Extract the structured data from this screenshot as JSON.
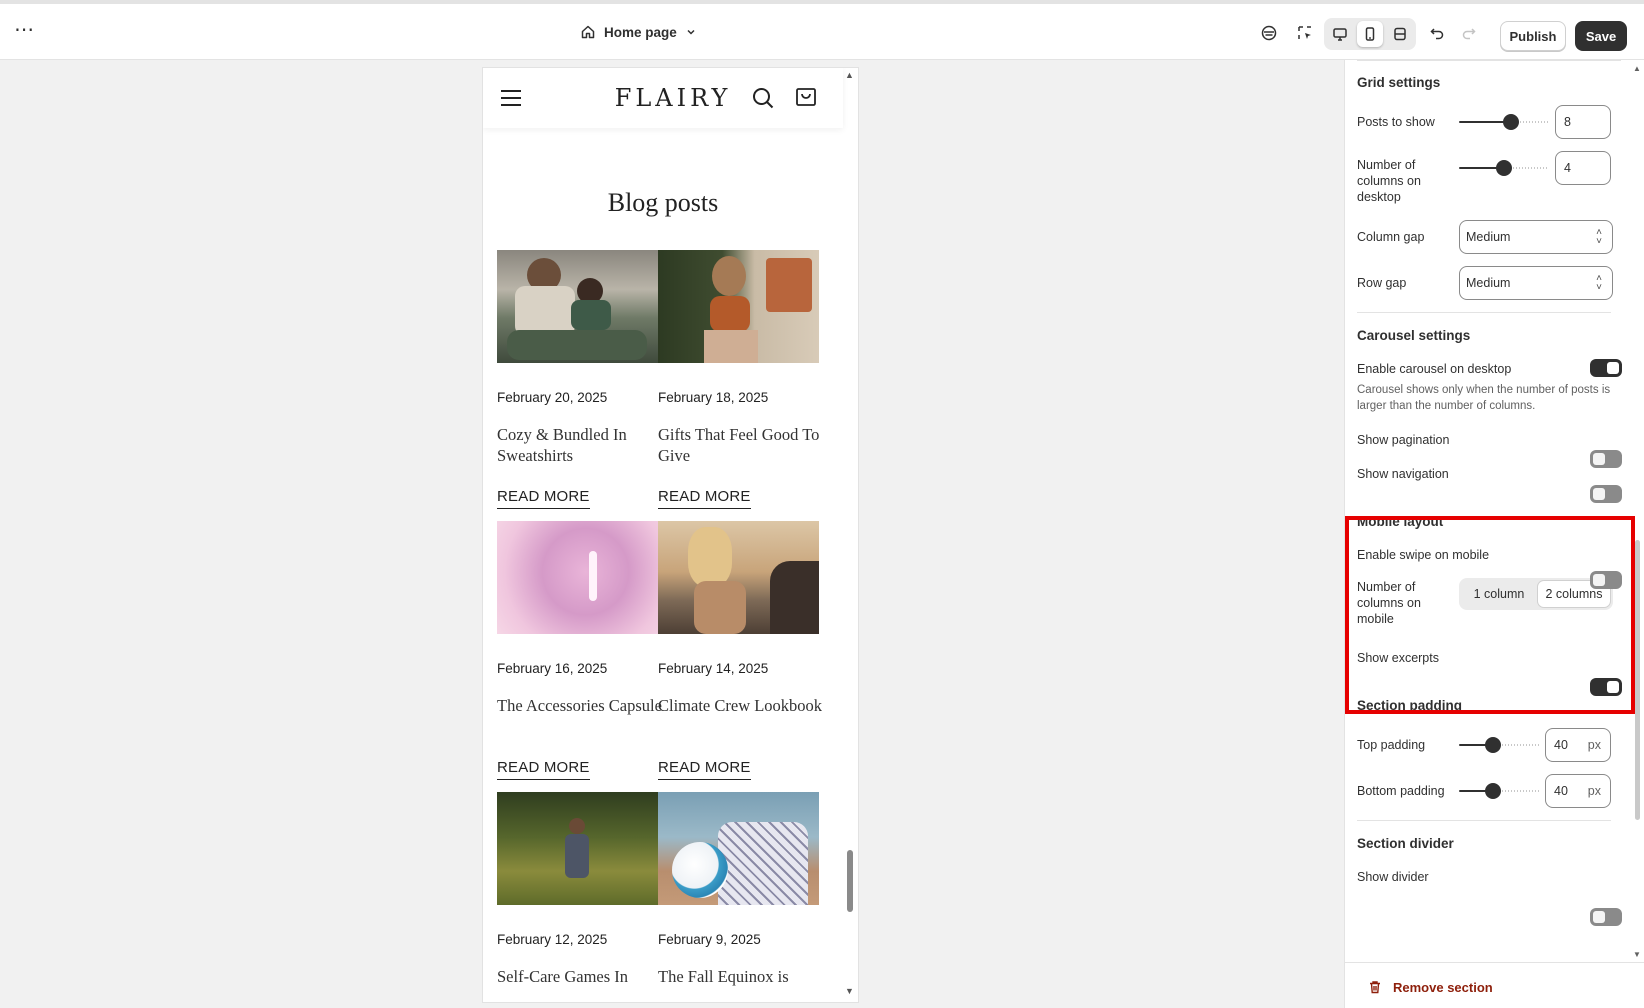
{
  "topbar": {
    "page_name": "Home page",
    "publish_label": "Publish",
    "save_label": "Save"
  },
  "store": {
    "logo": "FLAIRY",
    "section_title": "Blog posts",
    "posts": [
      {
        "date": "February 20, 2025",
        "title": "Cozy & Bundled In Sweatshirts",
        "read_more": "READ MORE"
      },
      {
        "date": "February 18, 2025",
        "title": "Gifts That Feel Good To Give",
        "read_more": "READ MORE"
      },
      {
        "date": "February 16, 2025",
        "title": "The Accessories Capsule",
        "read_more": "READ MORE"
      },
      {
        "date": "February 14, 2025",
        "title": "Climate Crew Lookbook",
        "read_more": "READ MORE"
      },
      {
        "date": "February 12, 2025",
        "title": "Self-Care Games In",
        "read_more": ""
      },
      {
        "date": "February 9, 2025",
        "title": "The Fall Equinox is",
        "read_more": ""
      }
    ]
  },
  "settings": {
    "grid": {
      "heading": "Grid settings",
      "posts_label": "Posts to show",
      "posts_value": "8",
      "posts_slider_fraction": 0.6,
      "columns_label": "Number of columns on desktop",
      "columns_value": "4",
      "columns_slider_fraction": 0.5,
      "column_gap_label": "Column gap",
      "column_gap_value": "Medium",
      "row_gap_label": "Row gap",
      "row_gap_value": "Medium"
    },
    "carousel": {
      "heading": "Carousel settings",
      "enable_label": "Enable carousel on desktop",
      "enable_on": true,
      "help": "Carousel shows only when the number of posts is larger than the number of columns.",
      "pagination_label": "Show pagination",
      "pagination_on": false,
      "navigation_label": "Show navigation",
      "navigation_on": false
    },
    "mobile": {
      "heading": "Mobile layout",
      "swipe_label": "Enable swipe on mobile",
      "swipe_on": false,
      "columns_label": "Number of columns on mobile",
      "option_1": "1 column",
      "option_2": "2 columns",
      "selected": "2 columns",
      "excerpts_label": "Show excerpts",
      "excerpts_on": true
    },
    "padding": {
      "heading": "Section padding",
      "top_label": "Top padding",
      "top_value": "40",
      "bottom_label": "Bottom padding",
      "bottom_value": "40",
      "unit": "px",
      "slider_fraction": 0.4
    },
    "divider": {
      "heading": "Section divider",
      "show_label": "Show divider",
      "show_on": false
    },
    "remove_label": "Remove section"
  },
  "colors": {
    "accent_dark": "#303030",
    "highlight": "#e60000",
    "remove": "#8e1f0b"
  }
}
